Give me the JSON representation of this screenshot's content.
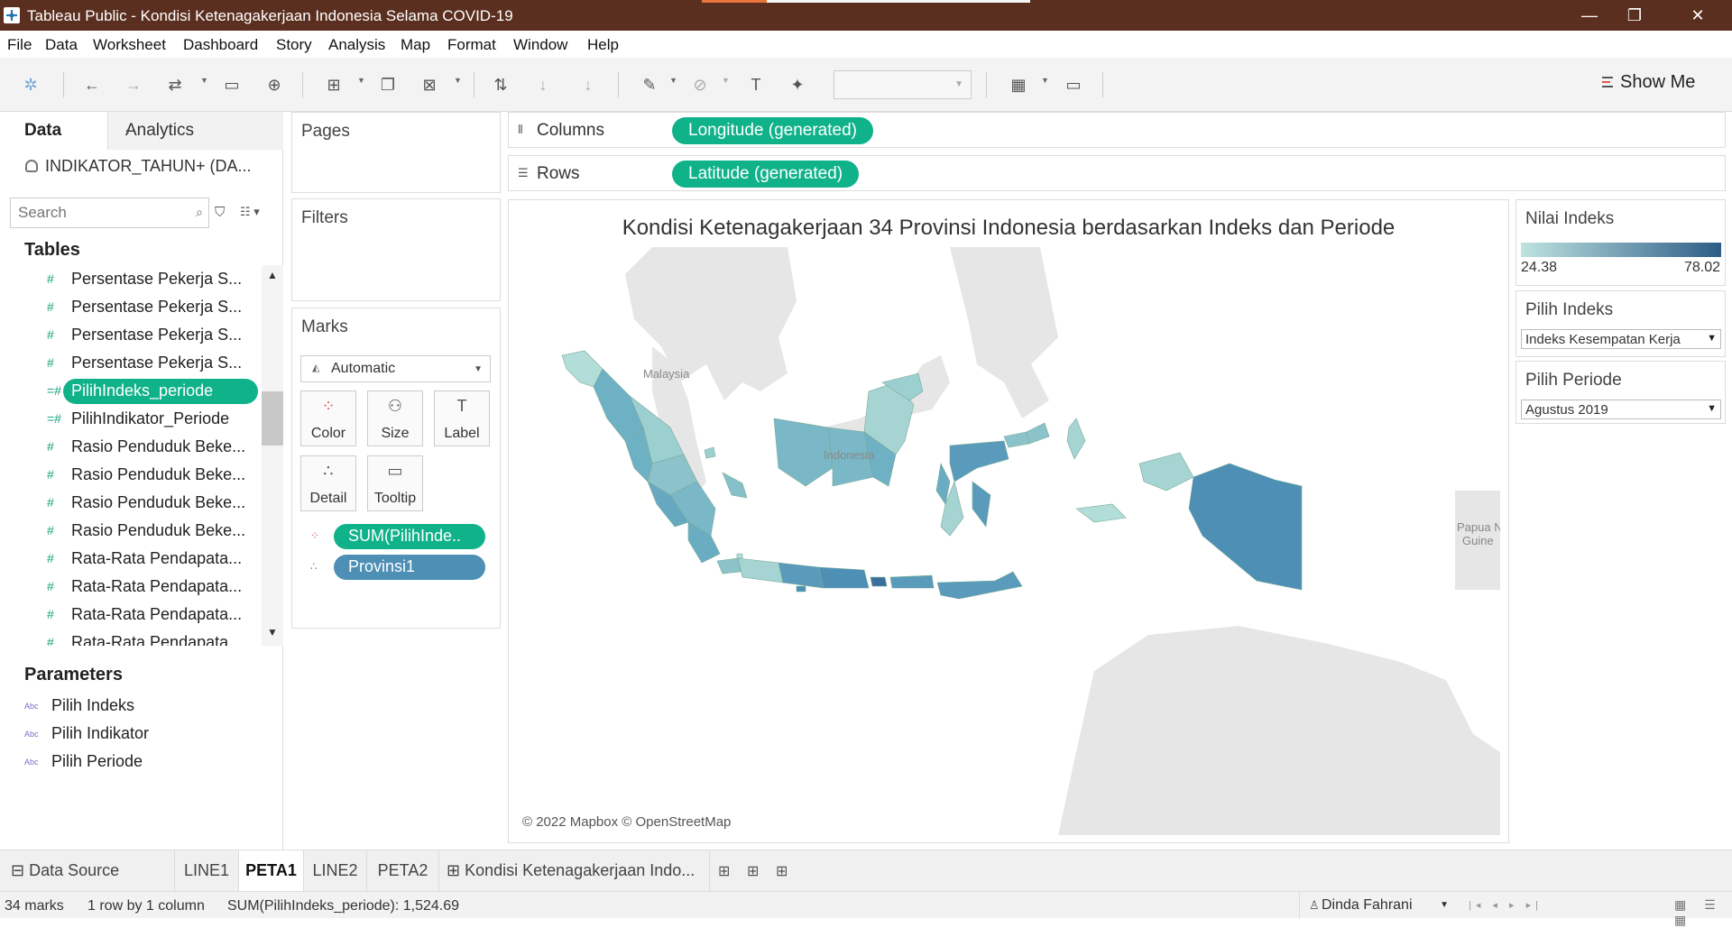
{
  "window": {
    "title": "Tableau Public - Kondisi Ketenagakerjaan Indonesia Selama COVID-19",
    "minimize": "—",
    "maximize": "❐",
    "close": "✕"
  },
  "menu": [
    "File",
    "Data",
    "Worksheet",
    "Dashboard",
    "Story",
    "Analysis",
    "Map",
    "Format",
    "Window",
    "Help"
  ],
  "toolbar": {
    "show_me": "Show Me",
    "fit_value": ""
  },
  "data_pane": {
    "tab_data": "Data",
    "tab_analytics": "Analytics",
    "collapse": "‹",
    "datasource": "INDIKATOR_TAHUN+ (DA...",
    "search_placeholder": "Search",
    "tables_heading": "Tables",
    "fields": [
      "Persentase Pekerja S...",
      "Persentase Pekerja S...",
      "Persentase Pekerja S...",
      "Persentase Pekerja S...",
      "PilihIndeks_periode",
      "PilihIndikator_Periode",
      "Rasio Penduduk Beke...",
      "Rasio Penduduk Beke...",
      "Rasio Penduduk Beke...",
      "Rasio Penduduk Beke...",
      "Rata-Rata Pendapata...",
      "Rata-Rata Pendapata...",
      "Rata-Rata Pendapata...",
      "Rata-Rata Pendapata..."
    ],
    "selected_field": "PilihIndeks_periode",
    "parameters_heading": "Parameters",
    "parameters": [
      "Pilih Indeks",
      "Pilih Indikator",
      "Pilih Periode"
    ]
  },
  "cards": {
    "pages": "Pages",
    "filters": "Filters",
    "marks": "Marks",
    "mark_type": "Automatic",
    "mark_buttons": [
      "Color",
      "Size",
      "Label",
      "Detail",
      "Tooltip"
    ],
    "mark_pills": [
      "SUM(PilihInde..",
      "Provinsi1"
    ]
  },
  "shelves": {
    "columns_label": "Columns",
    "columns_pill": "Longitude (generated)",
    "rows_label": "Rows",
    "rows_pill": "Latitude (generated)"
  },
  "viz": {
    "title": "Kondisi Ketenagakerjaan 34 Provinsi Indonesia berdasarkan Indeks dan Periode",
    "map_labels": [
      "Malaysia",
      "Indonesia",
      "Papua N",
      "Guine"
    ],
    "copyright": "© 2022 Mapbox © OpenStreetMap"
  },
  "legend": {
    "title": "Nilai Indeks",
    "min": "24.38",
    "max": "78.02",
    "color_low": "#bfe3e1",
    "color_high": "#2c5d87"
  },
  "params": {
    "indeks_title": "Pilih Indeks",
    "indeks_value": "Indeks Kesempatan Kerja",
    "periode_title": "Pilih Periode",
    "periode_value": "Agustus 2019"
  },
  "sheet_tabs": {
    "datasource": "Data Source",
    "tabs": [
      "LINE1",
      "PETA1",
      "LINE2",
      "PETA2"
    ],
    "active": "PETA1",
    "dashboard": "Kondisi Ketenagakerjaan Indo..."
  },
  "status": {
    "marks": "34 marks",
    "rows_cols": "1 row by 1 column",
    "sum": "SUM(PilihIndeks_periode): 1,524.69",
    "user": "Dinda Fahrani"
  },
  "colors": {
    "accent_green": "#10b28a",
    "pill_blue": "#4d8fb5",
    "titlebar": "#5a2f1f"
  }
}
